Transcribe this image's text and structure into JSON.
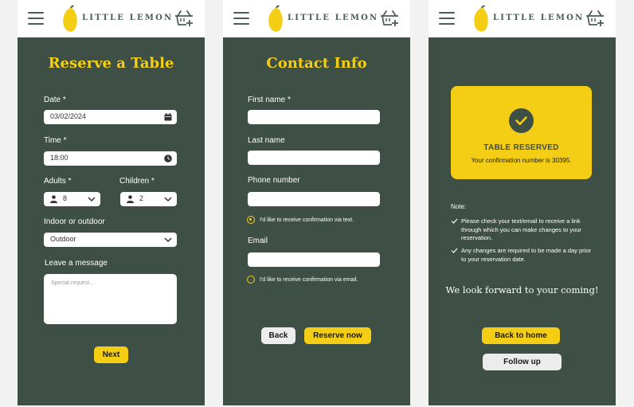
{
  "brand": {
    "name": "LITTLE LEMON"
  },
  "icons": {
    "menu": "hamburger-menu-icon",
    "logo": "lemon-icon",
    "basket": "shopping-basket-icon"
  },
  "colors": {
    "primary_green": "#495e57",
    "panel_green": "#3e4f46",
    "accent_yellow": "#f4ce14",
    "white": "#ffffff"
  },
  "reserve": {
    "title": "Reserve a Table",
    "date_label": "Date *",
    "date_value": "03/02/2024",
    "time_label": "Time *",
    "time_value": "18:00",
    "adults_label": "Adults *",
    "adults_value": "8",
    "children_label": "Children *",
    "children_value": "2",
    "seating_label": "Indoor or outdoor",
    "seating_value": "Outdoor",
    "message_label": "Leave a message",
    "message_placeholder": "Special request...",
    "next_label": "Next"
  },
  "contact": {
    "title": "Contact Info",
    "first_name_label": "First name *",
    "last_name_label": "Last name",
    "phone_label": "Phone number",
    "text_option": "I'd like to receive confirmation via text.",
    "text_option_checked": true,
    "email_label": "Email",
    "email_option": "I'd like to receive confirmation via email.",
    "email_option_checked": false,
    "back_label": "Back",
    "reserve_label": "Reserve now"
  },
  "confirmation": {
    "card_title": "TABLE RESERVED",
    "card_message": "Your confirmation number is 30395.",
    "note_label": "Note:",
    "notes": [
      "Please check your text/email to receive a link through which you can make changes to your reservation.",
      "Any changes are required to be made a day prior to your reservation date."
    ],
    "closing": "We look forward to your coming!",
    "home_label": "Back to home",
    "follow_label": "Follow up"
  }
}
